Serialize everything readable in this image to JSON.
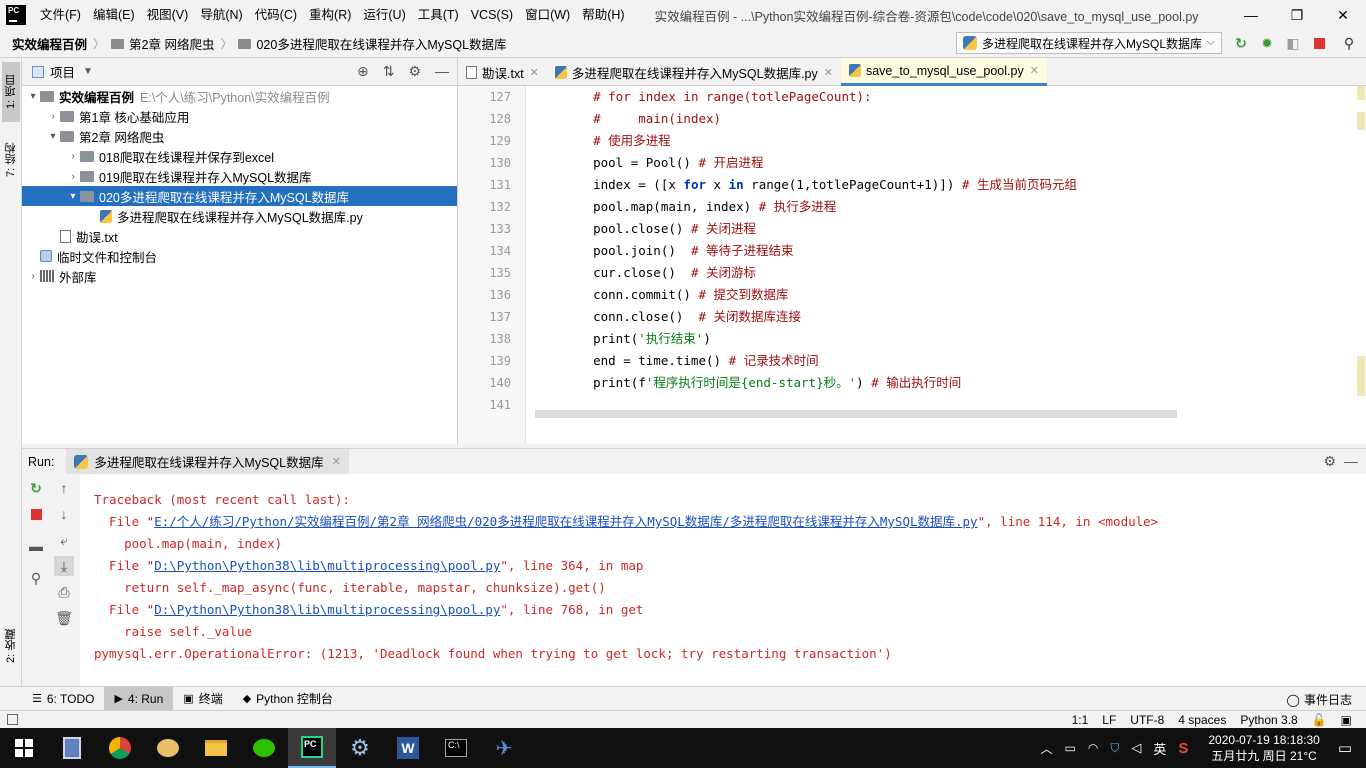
{
  "menubar": {
    "items": [
      "文件(F)",
      "编辑(E)",
      "视图(V)",
      "导航(N)",
      "代码(C)",
      "重构(R)",
      "运行(U)",
      "工具(T)",
      "VCS(S)",
      "窗口(W)",
      "帮助(H)"
    ],
    "window_title": "实效编程百例 - ...\\Python实效编程百例-综合卷-资源包\\code\\code\\020\\save_to_mysql_use_pool.py",
    "logo": "PC"
  },
  "navbar": {
    "crumbs": [
      "实效编程百例",
      "第2章 网络爬虫",
      "020多进程爬取在线课程并存入MySQL数据库"
    ],
    "run_config": "多进程爬取在线课程并存入MySQL数据库"
  },
  "left_strip": {
    "project_tab": "1: 项目",
    "structure_tab": "7: 结构",
    "favorites_tab": "2: 收藏"
  },
  "project": {
    "header": "项目",
    "tree": [
      {
        "label": "实效编程百例",
        "path": "E:\\个人\\练习\\Python\\实效编程百例",
        "indent": 0,
        "arrow": "▾",
        "icon": "folder",
        "bold": true
      },
      {
        "label": "第1章 核心基础应用",
        "indent": 1,
        "arrow": "›",
        "icon": "folder"
      },
      {
        "label": "第2章 网络爬虫",
        "indent": 1,
        "arrow": "▾",
        "icon": "folder"
      },
      {
        "label": "018爬取在线课程并保存到excel",
        "indent": 2,
        "arrow": "›",
        "icon": "folder"
      },
      {
        "label": "019爬取在线课程并存入MySQL数据库",
        "indent": 2,
        "arrow": "›",
        "icon": "folder"
      },
      {
        "label": "020多进程爬取在线课程并存入MySQL数据库",
        "indent": 2,
        "arrow": "▾",
        "icon": "folder",
        "selected": true
      },
      {
        "label": "多进程爬取在线课程并存入MySQL数据库.py",
        "indent": 3,
        "arrow": "",
        "icon": "py"
      },
      {
        "label": "勘误.txt",
        "indent": 1,
        "arrow": "",
        "icon": "txt"
      },
      {
        "label": "临时文件和控制台",
        "indent": 0,
        "arrow": "",
        "icon": "scratch"
      },
      {
        "label": "外部库",
        "indent": 0,
        "arrow": "›",
        "icon": "lib"
      }
    ]
  },
  "editor_tabs": [
    {
      "label": "勘误.txt",
      "icon": "txt"
    },
    {
      "label": "多进程爬取在线课程并存入MySQL数据库.py",
      "icon": "py"
    },
    {
      "label": "save_to_mysql_use_pool.py",
      "icon": "py",
      "active": true
    }
  ],
  "code": {
    "line_numbers": [
      "127",
      "128",
      "129",
      "130",
      "131",
      "132",
      "133",
      "134",
      "135",
      "136",
      "137",
      "138",
      "139",
      "140",
      "141"
    ],
    "lines": [
      "    # for index in range(totlePageCount):",
      "    #     main(index)",
      "    # 使用多进程",
      "    pool = Pool() # 开启进程",
      "    index = ([x for x in range(1,totlePageCount+1)]) # 生成当前页码元组",
      "    pool.map(main, index) # 执行多进程",
      "    pool.close() # 关闭进程",
      "    pool.join()  # 等待子进程结束",
      "    cur.close()  # 关闭游标",
      "    conn.commit() # 提交到数据库",
      "    conn.close()  # 关闭数据库连接",
      "    print('执行结束')",
      "    end = time.time() # 记录技术时间",
      "    print(f'程序执行时间是{end-start}秒。') # 输出执行时间",
      ""
    ]
  },
  "run": {
    "label": "Run:",
    "tab": "多进程爬取在线课程并存入MySQL数据库",
    "console": [
      {
        "text": "Traceback (most recent call last):"
      },
      {
        "pre": "  File \"",
        "link": "E:/个人/练习/Python/实效编程百例/第2章 网络爬虫/020多进程爬取在线课程并存入MySQL数据库/多进程爬取在线课程并存入MySQL数据库.py",
        "post": "\", line 114, in <module>"
      },
      {
        "text": "    pool.map(main, index)"
      },
      {
        "pre": "  File \"",
        "link": "D:\\Python\\Python38\\lib\\multiprocessing\\pool.py",
        "post": "\", line 364, in map"
      },
      {
        "text": "    return self._map_async(func, iterable, mapstar, chunksize).get()"
      },
      {
        "pre": "  File \"",
        "link": "D:\\Python\\Python38\\lib\\multiprocessing\\pool.py",
        "post": "\", line 768, in get"
      },
      {
        "text": "    raise self._value"
      },
      {
        "text": "pymysql.err.OperationalError: (1213, 'Deadlock found when trying to get lock; try restarting transaction')"
      }
    ]
  },
  "bottom_tabs": [
    {
      "label": "6: TODO",
      "icon": "☰"
    },
    {
      "label": "4: Run",
      "icon": "▶",
      "selected": true
    },
    {
      "label": "终端",
      "icon": "▣"
    },
    {
      "label": "Python 控制台",
      "icon": "◆"
    }
  ],
  "event_log": "事件日志",
  "status": {
    "position": "1:1",
    "line_sep": "LF",
    "encoding": "UTF-8",
    "indent": "4 spaces",
    "interpreter": "Python 3.8"
  },
  "taskbar": {
    "apps": [
      "windows-start",
      "calculator",
      "chrome",
      "paint",
      "file-explorer",
      "wechat",
      "pycharm",
      "settings",
      "word",
      "cmd",
      "ghost"
    ],
    "ime": "英",
    "clock_time": "2020-07-19  18:18:30",
    "clock_date": "五月廿九 周日 21°C"
  }
}
